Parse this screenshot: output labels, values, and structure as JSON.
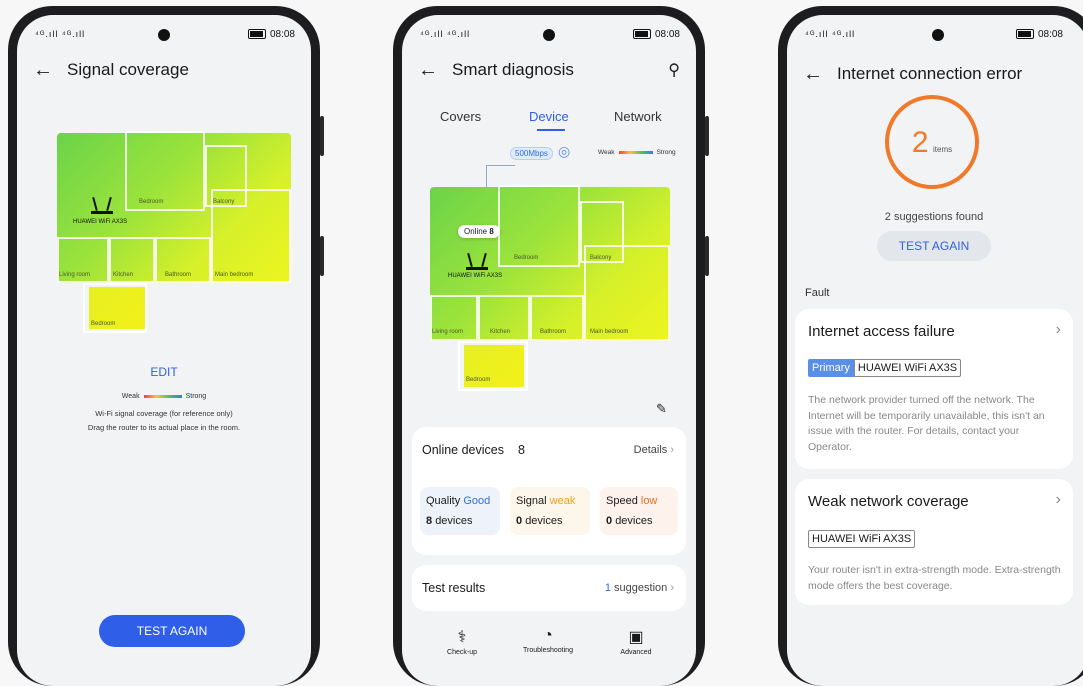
{
  "status": {
    "signal": "⁴ᴳ.ıll ⁴ᴳ.ıll ",
    "time": "08:08"
  },
  "phone1": {
    "title": "Signal coverage",
    "rooms": {
      "bedroom_top": "Bedroom",
      "balcony": "Balcony",
      "living_room": "Living room",
      "kitchen": "Kitchen",
      "bathroom": "Bathroom",
      "main_bedroom": "Main bedroom",
      "bedroom_bottom": "Bedroom"
    },
    "router_label": "HUAWEI WiFi AX3S",
    "edit_label": "EDIT",
    "legend": {
      "weak": "Weak",
      "strong": "Strong"
    },
    "note1": "Wi-Fi signal coverage (for reference only)",
    "note2": "Drag the router to its actual place in the room.",
    "test_again": "TEST AGAIN"
  },
  "phone2": {
    "title": "Smart diagnosis",
    "tabs": [
      {
        "label": "Covers"
      },
      {
        "label": "Device"
      },
      {
        "label": "Network"
      }
    ],
    "speed_badge": "500Mbps",
    "legend": {
      "weak": "Weak",
      "strong": "Strong"
    },
    "online_bubble": {
      "label": "Online",
      "count": "8"
    },
    "router_label": "HUAWEI WiFi AX3S",
    "rooms": {
      "bedroom_top": "Bedroom",
      "balcony": "Balcony",
      "living_room": "Living room",
      "kitchen": "Kitchen",
      "bathroom": "Bathroom",
      "main_bedroom": "Main bedroom",
      "bedroom_bottom": "Bedroom"
    },
    "online_devices": {
      "label": "Online devices",
      "count": "8",
      "details": "Details"
    },
    "stats": [
      {
        "label": "Quality",
        "grade": "Good",
        "grade_color": "#2f6fe0",
        "value": "8",
        "unit": "devices"
      },
      {
        "label": "Signal",
        "grade": "weak",
        "grade_color": "#f0a020",
        "value": "0",
        "unit": "devices"
      },
      {
        "label": "Speed",
        "grade": "low",
        "grade_color": "#f07020",
        "value": "0",
        "unit": "devices"
      }
    ],
    "test_results": {
      "label": "Test results",
      "count": "1",
      "suffix": "suggestion"
    },
    "bottom_tabs": [
      {
        "label": "Check-up",
        "icon": "stethoscope-icon"
      },
      {
        "label": "Troubleshooting",
        "icon": "gauge-icon"
      },
      {
        "label": "Advanced",
        "icon": "toolbox-icon"
      }
    ]
  },
  "phone3": {
    "title": "Internet connection error",
    "ring": {
      "count": "2",
      "unit": "items"
    },
    "suggestions": "2 suggestions found",
    "test_again": "TEST AGAIN",
    "section": "Fault",
    "fault1": {
      "title": "Internet access failure",
      "tag_primary": "Primary",
      "tag_device": "HUAWEI WiFi AX3S",
      "desc": "The network provider turned off the network. The Internet will be temporarily unavailable, this isn't an issue with the router. For details, contact your Operator."
    },
    "fault2": {
      "title": "Weak network coverage",
      "tag_device": "HUAWEI WiFi AX3S",
      "desc": "Your router isn't in extra-strength mode. Extra-strength mode offers the best coverage."
    }
  },
  "colors": {
    "accent": "#2f5fe8",
    "ring": "#f07a2a"
  }
}
